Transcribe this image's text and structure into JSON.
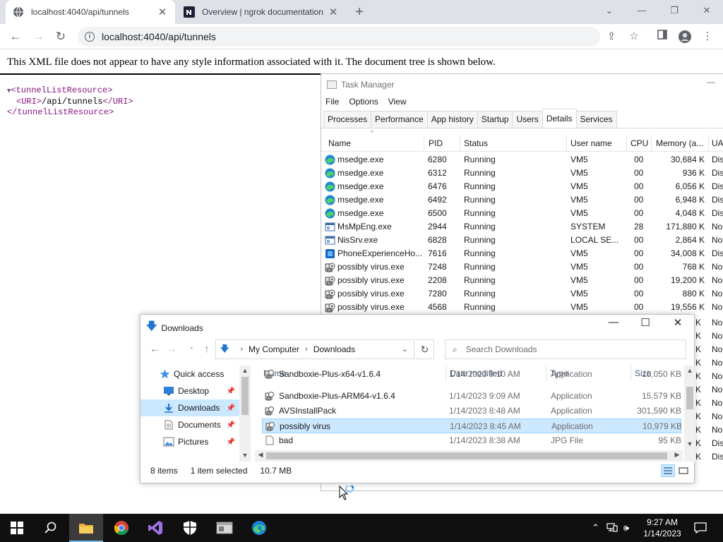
{
  "browser": {
    "tabs": [
      {
        "title": "localhost:4040/api/tunnels",
        "close": "✕"
      },
      {
        "title": "Overview | ngrok documentation",
        "close": "✕"
      }
    ],
    "new_tab": "+",
    "url": "localhost:4040/api/tunnels",
    "xml_message": "This XML file does not appear to have any style information associated with it. The document tree is shown below.",
    "xml_tree": {
      "line1": "<tunnelListResource>",
      "uri_open": "<URI>",
      "uri_text": "/api/tunnels",
      "uri_close": "</URI>",
      "line3": "</tunnelListResource>"
    }
  },
  "task_manager": {
    "title": "Task Manager",
    "menu": [
      "File",
      "Options",
      "View"
    ],
    "tabs": [
      "Processes",
      "Performance",
      "App history",
      "Startup",
      "Users",
      "Details",
      "Services"
    ],
    "selected_tab": "Details",
    "columns": [
      "Name",
      "PID",
      "Status",
      "User name",
      "CPU",
      "Memory (a...",
      "UA"
    ],
    "rows": [
      {
        "name": "msedge.exe",
        "pid": "6280",
        "status": "Running",
        "user": "VM5",
        "cpu": "00",
        "mem": "30,684 K",
        "ua": "Dis",
        "icon": "edge-icon"
      },
      {
        "name": "msedge.exe",
        "pid": "6312",
        "status": "Running",
        "user": "VM5",
        "cpu": "00",
        "mem": "936 K",
        "ua": "Dis",
        "icon": "edge-icon"
      },
      {
        "name": "msedge.exe",
        "pid": "6476",
        "status": "Running",
        "user": "VM5",
        "cpu": "00",
        "mem": "6,056 K",
        "ua": "Dis",
        "icon": "edge-icon"
      },
      {
        "name": "msedge.exe",
        "pid": "6492",
        "status": "Running",
        "user": "VM5",
        "cpu": "00",
        "mem": "6,948 K",
        "ua": "Dis",
        "icon": "edge-icon"
      },
      {
        "name": "msedge.exe",
        "pid": "6500",
        "status": "Running",
        "user": "VM5",
        "cpu": "00",
        "mem": "4,048 K",
        "ua": "Dis",
        "icon": "edge-icon"
      },
      {
        "name": "MsMpEng.exe",
        "pid": "2944",
        "status": "Running",
        "user": "SYSTEM",
        "cpu": "28",
        "mem": "171,880 K",
        "ua": "No",
        "icon": "service-icon"
      },
      {
        "name": "NisSrv.exe",
        "pid": "6828",
        "status": "Running",
        "user": "LOCAL SE...",
        "cpu": "00",
        "mem": "2,864 K",
        "ua": "No",
        "icon": "service-icon"
      },
      {
        "name": "PhoneExperienceHo...",
        "pid": "7616",
        "status": "Running",
        "user": "VM5",
        "cpu": "00",
        "mem": "34,008 K",
        "ua": "Dis",
        "icon": "app-icon"
      },
      {
        "name": "possibly virus.exe",
        "pid": "7248",
        "status": "Running",
        "user": "VM5",
        "cpu": "00",
        "mem": "768 K",
        "ua": "No",
        "icon": "installer-icon"
      },
      {
        "name": "possibly virus.exe",
        "pid": "2208",
        "status": "Running",
        "user": "VM5",
        "cpu": "00",
        "mem": "19,200 K",
        "ua": "No",
        "icon": "installer-icon"
      },
      {
        "name": "possibly virus.exe",
        "pid": "7280",
        "status": "Running",
        "user": "VM5",
        "cpu": "00",
        "mem": "880 K",
        "ua": "No",
        "icon": "installer-icon"
      },
      {
        "name": "possibly virus.exe",
        "pid": "4568",
        "status": "Running",
        "user": "VM5",
        "cpu": "00",
        "mem": "19,556 K",
        "ua": "No",
        "icon": "installer-icon"
      }
    ],
    "hidden_rows_tail": [
      {
        "mem": "K",
        "ua": "No"
      },
      {
        "mem": "K",
        "ua": "No"
      },
      {
        "mem": "K",
        "ua": "No"
      },
      {
        "mem": "K",
        "ua": "No"
      },
      {
        "mem": "K",
        "ua": "No"
      },
      {
        "mem": "K",
        "ua": "No"
      },
      {
        "mem": "K",
        "ua": "No"
      },
      {
        "mem": "K",
        "ua": "No"
      },
      {
        "mem": "K",
        "ua": "No"
      },
      {
        "mem": "K",
        "ua": "Dis"
      },
      {
        "mem": "K",
        "ua": "Dis"
      }
    ]
  },
  "explorer": {
    "title": "Downloads",
    "window_controls": [
      "—",
      "☐",
      "✕"
    ],
    "breadcrumb": [
      "My Computer",
      "Downloads"
    ],
    "search_placeholder": "Search Downloads",
    "nav": [
      {
        "label": "Quick access",
        "icon": "star-icon",
        "pinned": false
      },
      {
        "label": "Desktop",
        "icon": "desktop-icon",
        "pinned": true
      },
      {
        "label": "Downloads",
        "icon": "download-icon",
        "pinned": true,
        "selected": true
      },
      {
        "label": "Documents",
        "icon": "document-icon",
        "pinned": true
      },
      {
        "label": "Pictures",
        "icon": "picture-icon",
        "pinned": true
      }
    ],
    "columns": [
      "Name",
      "Date modified",
      "Type",
      "Size"
    ],
    "files": [
      {
        "name": "Sandboxie-Plus-x64-v1.6.4",
        "date": "1/14/2023 9:10 AM",
        "type": "Application",
        "size": "18,050 KB",
        "partial": true
      },
      {
        "name": "Sandboxie-Plus-ARM64-v1.6.4",
        "date": "1/14/2023 9:09 AM",
        "type": "Application",
        "size": "15,579 KB"
      },
      {
        "name": "AVSInstallPack",
        "date": "1/14/2023 8:48 AM",
        "type": "Application",
        "size": "301,590 KB"
      },
      {
        "name": "possibly virus",
        "date": "1/14/2023 8:45 AM",
        "type": "Application",
        "size": "10,979 KB",
        "selected": true
      },
      {
        "name": "bad",
        "date": "1/14/2023 8:38 AM",
        "type": "JPG File",
        "size": "95 KB"
      }
    ],
    "status": {
      "items": "8 items",
      "selected": "1 item selected",
      "size": "10.7 MB"
    }
  },
  "taskbar": {
    "apps": [
      "windows-start-icon",
      "search-icon",
      "file-explorer-icon",
      "chrome-icon",
      "visual-studio-icon",
      "security-shield-icon",
      "app-window-icon",
      "edge-icon"
    ],
    "time": "9:27 AM",
    "date": "1/14/2023"
  },
  "colors": {
    "accent": "#1e74d4",
    "selection": "#cce8ff",
    "taskbar": "#101010"
  }
}
